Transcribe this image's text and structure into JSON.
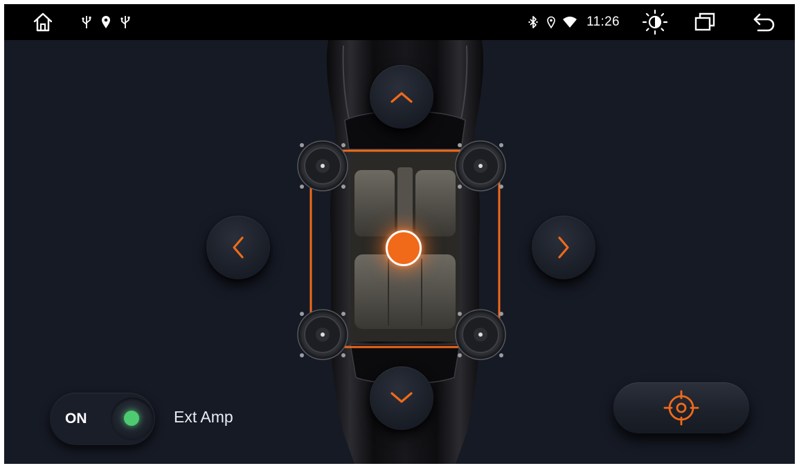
{
  "statusbar": {
    "time": "11:26",
    "left_icons": [
      "home-icon",
      "usb-icon",
      "location-pin-icon",
      "usb-icon"
    ],
    "right_icons": [
      "bluetooth-icon",
      "location-icon",
      "wifi-icon",
      "brightness-icon",
      "recent-apps-icon",
      "back-icon"
    ]
  },
  "fader": {
    "controls": [
      "up",
      "down",
      "left",
      "right"
    ],
    "speakers": [
      "front-left",
      "front-right",
      "rear-left",
      "rear-right"
    ]
  },
  "ext_amp": {
    "state": "ON",
    "label": "Ext Amp",
    "enabled": true
  },
  "colors": {
    "accent": "#f06a1a",
    "background": "#161a25",
    "statusbar": "#000000",
    "toggle_on": "#4ecb71"
  }
}
